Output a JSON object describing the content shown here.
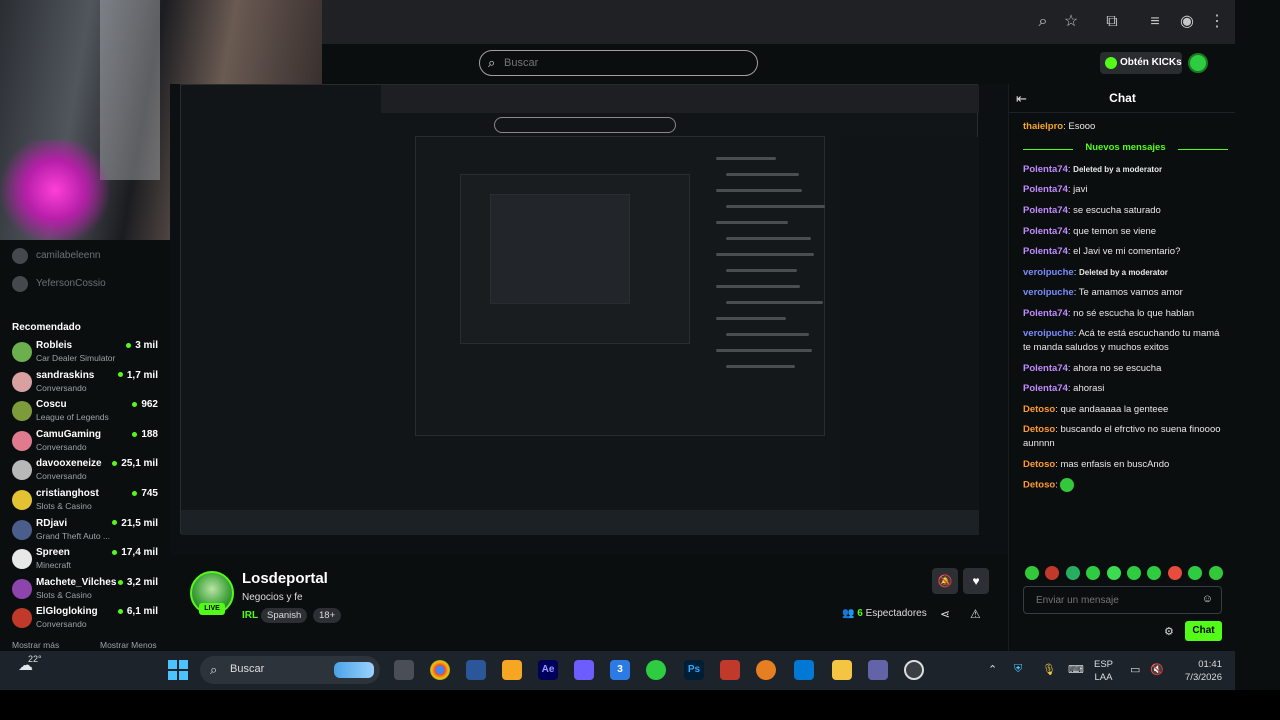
{
  "search": {
    "placeholder": "Buscar"
  },
  "header": {
    "kicks_label": "Obtén KICKs"
  },
  "sidebar": {
    "following": [
      {
        "name": "camilabeleenn"
      },
      {
        "name": "YefersonCossio"
      }
    ],
    "recommended_title": "Recomendado",
    "recommended": [
      {
        "name": "Robleis",
        "category": "Car Dealer Simulator",
        "viewers": "3 mil",
        "color": "#6ab04c"
      },
      {
        "name": "sandraskins",
        "category": "Conversando",
        "viewers": "1,7 mil",
        "color": "#d8a0a0"
      },
      {
        "name": "Coscu",
        "category": "League of Legends",
        "viewers": "962",
        "color": "#7d9b3a"
      },
      {
        "name": "CamuGaming",
        "category": "Conversando",
        "viewers": "188",
        "color": "#e07a8f"
      },
      {
        "name": "davooxeneize",
        "category": "Conversando",
        "viewers": "25,1 mil",
        "color": "#b8b8b8"
      },
      {
        "name": "cristianghost",
        "category": "Slots & Casino",
        "viewers": "745",
        "color": "#e3c233"
      },
      {
        "name": "RDjavi",
        "category": "Grand Theft Auto ...",
        "viewers": "21,5 mil",
        "color": "#4b5d8a"
      },
      {
        "name": "Spreen",
        "category": "Minecraft",
        "viewers": "17,4 mil",
        "color": "#e8e8e8"
      },
      {
        "name": "Machete_Vilches",
        "category": "Slots & Casino",
        "viewers": "3,2 mil",
        "color": "#8e44ad"
      },
      {
        "name": "ElGlogloking",
        "category": "Conversando",
        "viewers": "6,1 mil",
        "color": "#c0392b"
      }
    ],
    "show_more": "Mostrar más",
    "show_less": "Mostrar Menos"
  },
  "stream": {
    "streamer": "Losdeportal",
    "live_badge": "LIVE",
    "title": "Negocios y fe",
    "category": "IRL",
    "tags": [
      "Spanish",
      "18+"
    ],
    "viewers_count": "6",
    "viewers_label": "Espectadores"
  },
  "chat": {
    "title": "Chat",
    "new_messages": "Nuevos mensajes",
    "messages": [
      {
        "user": "thaielpro",
        "text": "Esooo",
        "color": "#f5a623"
      },
      {
        "user": "Polenta74",
        "text": "Deleted by a moderator",
        "color": "#c18cff",
        "deleted": true
      },
      {
        "user": "Polenta74",
        "text": "javi",
        "color": "#c18cff"
      },
      {
        "user": "Polenta74",
        "text": "se escucha saturado",
        "color": "#c18cff"
      },
      {
        "user": "Polenta74",
        "text": "que temon se viene",
        "color": "#c18cff"
      },
      {
        "user": "Polenta74",
        "text": "el Javi ve mi comentario?",
        "color": "#c18cff"
      },
      {
        "user": "veroipuche",
        "text": "Deleted by a moderator",
        "color": "#7b8cff",
        "deleted": true
      },
      {
        "user": "veroipuche",
        "text": "Te amamos vamos amor",
        "color": "#7b8cff"
      },
      {
        "user": "Polenta74",
        "text": "no sé escucha lo que hablan",
        "color": "#c18cff"
      },
      {
        "user": "veroipuche",
        "text": "Acá te está escuchando tu mamá te manda saludos y muchos exitos",
        "color": "#7b8cff"
      },
      {
        "user": "Polenta74",
        "text": "ahora no se escucha",
        "color": "#c18cff"
      },
      {
        "user": "Polenta74",
        "text": "ahorasi",
        "color": "#c18cff"
      },
      {
        "user": "Detoso",
        "text": "que andaaaaa la genteee",
        "color": "#ff9a2e"
      },
      {
        "user": "Detoso",
        "text": "buscando el efrctivo no suena finoooo aunnnn",
        "color": "#ff9a2e"
      },
      {
        "user": "Detoso",
        "text": "mas enfasis en buscAndo",
        "color": "#ff9a2e"
      },
      {
        "user": "Detoso",
        "text": "",
        "color": "#ff9a2e"
      }
    ],
    "input_placeholder": "Enviar un mensaje",
    "send_label": "Chat"
  },
  "taskbar": {
    "temperature": "22°",
    "search_label": "Buscar",
    "lang_line1": "ESP",
    "lang_line2": "LAA",
    "time": "01:41",
    "date": "7/3/2026"
  }
}
